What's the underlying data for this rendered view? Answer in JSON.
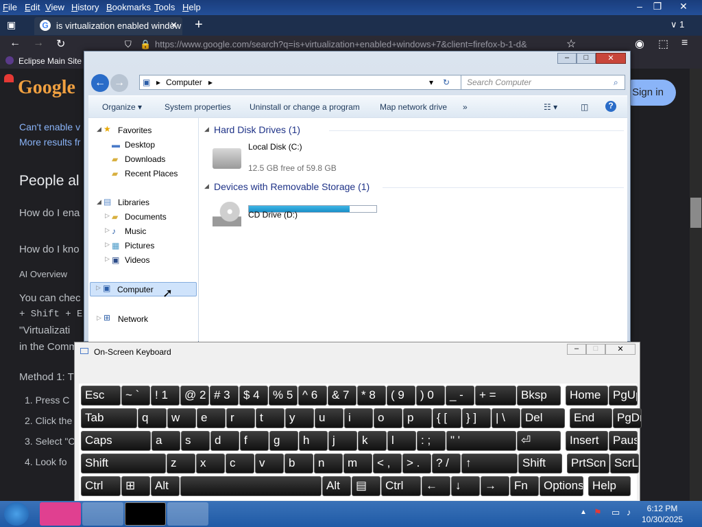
{
  "menubar": {
    "items": [
      {
        "u": "F",
        "r": "ile"
      },
      {
        "u": "E",
        "r": "dit"
      },
      {
        "u": "V",
        "r": "iew"
      },
      {
        "u": "H",
        "r": "istory"
      },
      {
        "u": "B",
        "r": "ookmarks"
      },
      {
        "u": "T",
        "r": "ools"
      },
      {
        "u": "H",
        "r": "elp"
      }
    ]
  },
  "tabs": {
    "active_title": "is virtualization enabled window",
    "count": "1"
  },
  "url": "https://www.google.com/search?q=is+virtualization+enabled+windows+7&client=firefox-b-1-d&",
  "bookmarks": {
    "item": "Eclipse Main Site"
  },
  "page": {
    "logo": "Google",
    "sign_in": "Sign in",
    "lines": [
      "Can't enable v",
      "More results fr",
      "People al",
      "How do I ena",
      "How do I kno",
      "AI Overview",
      "You can chec",
      "+ Shift + E",
      "\"Virtualizati",
      "in the Comm",
      "Method 1: T"
    ],
    "steps": [
      "1.  Press  C",
      "2.  Click the",
      "3.  Select \"C",
      "4.  Look fo"
    ]
  },
  "explorer": {
    "breadcrumb": "Computer",
    "search_placeholder": "Search Computer",
    "commands": [
      "Organize ▾",
      "System properties",
      "Uninstall or change a program",
      "Map network drive",
      "»"
    ],
    "nav": {
      "favorites": "Favorites",
      "fav_items": [
        "Desktop",
        "Downloads",
        "Recent Places"
      ],
      "libraries": "Libraries",
      "lib_items": [
        "Documents",
        "Music",
        "Pictures",
        "Videos"
      ],
      "computer": "Computer",
      "network": "Network"
    },
    "groups": [
      {
        "title": "Hard Disk Drives (1)"
      },
      {
        "title": "Devices with Removable Storage (1)"
      }
    ],
    "drives": [
      {
        "name": "Local Disk (C:)",
        "free": "12.5 GB free of 59.8 GB",
        "used_fraction": 0.79
      },
      {
        "name": "CD Drive (D:)"
      }
    ]
  },
  "osk": {
    "title": "On-Screen Keyboard",
    "rows": [
      [
        "Esc",
        "~ `",
        "! 1",
        "@ 2",
        "# 3",
        "$ 4",
        "% 5",
        "^ 6",
        "& 7",
        "* 8",
        "( 9",
        ") 0",
        "_ -",
        "+ =",
        "Bksp",
        "Home",
        "PgUp"
      ],
      [
        "Tab",
        "q",
        "w",
        "e",
        "r",
        "t",
        "y",
        "u",
        "i",
        "o",
        "p",
        "{ [",
        "} ]",
        "| \\",
        "Del",
        "End",
        "PgDn"
      ],
      [
        "Caps",
        "a",
        "s",
        "d",
        "f",
        "g",
        "h",
        "j",
        "k",
        "l",
        ": ;",
        "\" '",
        "⏎",
        "Insert",
        "Pause"
      ],
      [
        "Shift",
        "z",
        "x",
        "c",
        "v",
        "b",
        "n",
        "m",
        "< ,",
        "> .",
        "? /",
        "↑",
        "Shift",
        "PrtScn",
        "ScrLk"
      ],
      [
        "Ctrl",
        "⊞",
        "Alt",
        "",
        "Alt",
        "▤",
        "Ctrl",
        "←",
        "↓",
        "→",
        "Fn",
        "Options",
        "Help"
      ]
    ]
  },
  "clock": {
    "time": "6:12 PM",
    "date": "10/30/2025"
  }
}
